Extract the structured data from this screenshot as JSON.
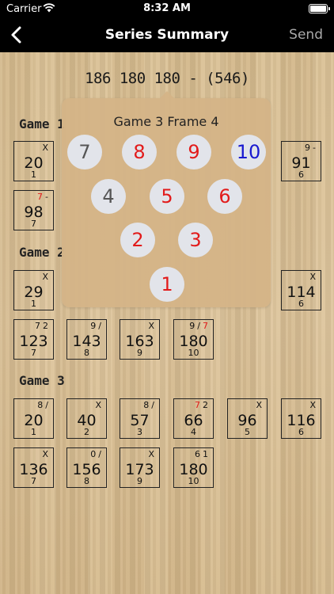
{
  "status": {
    "carrier": "Carrier",
    "time": "8:32 AM"
  },
  "nav": {
    "title": "Series Summary",
    "send": "Send"
  },
  "series_total": "186 180 180 - (546)",
  "games": [
    {
      "label": "Game 1",
      "frames": [
        {
          "num": "1",
          "score": "20",
          "marks": [
            "X"
          ]
        },
        {
          "num": "6",
          "score": "91",
          "marks": [
            "9",
            "-"
          ]
        },
        {
          "num": "7",
          "score": "98",
          "marks": [
            "7",
            "-"
          ],
          "red": [
            0
          ]
        }
      ]
    },
    {
      "label": "Game 2",
      "frames": [
        {
          "num": "1",
          "score": "29",
          "marks": [
            "X"
          ]
        },
        {
          "num": "6",
          "score": "114",
          "marks": [
            "X"
          ]
        },
        {
          "num": "7",
          "score": "123",
          "marks": [
            "7",
            "2"
          ]
        },
        {
          "num": "8",
          "score": "143",
          "marks": [
            "9",
            "/"
          ]
        },
        {
          "num": "9",
          "score": "163",
          "marks": [
            "X"
          ]
        },
        {
          "num": "10",
          "score": "180",
          "marks": [
            "9",
            "/",
            "7"
          ],
          "red": [
            2
          ]
        }
      ]
    },
    {
      "label": "Game 3",
      "frames": [
        {
          "num": "1",
          "score": "20",
          "marks": [
            "8",
            "/"
          ]
        },
        {
          "num": "2",
          "score": "40",
          "marks": [
            "X"
          ]
        },
        {
          "num": "3",
          "score": "57",
          "marks": [
            "8",
            "/"
          ]
        },
        {
          "num": "4",
          "score": "66",
          "marks": [
            "7",
            "2"
          ],
          "red": [
            0
          ]
        },
        {
          "num": "5",
          "score": "96",
          "marks": [
            "X"
          ]
        },
        {
          "num": "6",
          "score": "116",
          "marks": [
            "X"
          ]
        },
        {
          "num": "7",
          "score": "136",
          "marks": [
            "X"
          ]
        },
        {
          "num": "8",
          "score": "156",
          "marks": [
            "0",
            "/"
          ]
        },
        {
          "num": "9",
          "score": "173",
          "marks": [
            "X"
          ]
        },
        {
          "num": "10",
          "score": "180",
          "marks": [
            "6",
            "1"
          ]
        }
      ]
    }
  ],
  "popover": {
    "title": "Game 3 Frame 4",
    "pins": [
      {
        "label": "7",
        "state": "standing",
        "color": "#555555"
      },
      {
        "label": "8",
        "state": "down-first",
        "color": "#e21b1b"
      },
      {
        "label": "9",
        "state": "down-first",
        "color": "#e21b1b"
      },
      {
        "label": "10",
        "state": "down-second",
        "color": "#1a1ad0"
      },
      {
        "label": "4",
        "state": "standing",
        "color": "#555555"
      },
      {
        "label": "5",
        "state": "down-first",
        "color": "#e21b1b"
      },
      {
        "label": "6",
        "state": "down-first",
        "color": "#e21b1b"
      },
      {
        "label": "2",
        "state": "down-first",
        "color": "#e21b1b"
      },
      {
        "label": "3",
        "state": "down-first",
        "color": "#e21b1b"
      },
      {
        "label": "1",
        "state": "down-first",
        "color": "#e21b1b"
      }
    ]
  }
}
